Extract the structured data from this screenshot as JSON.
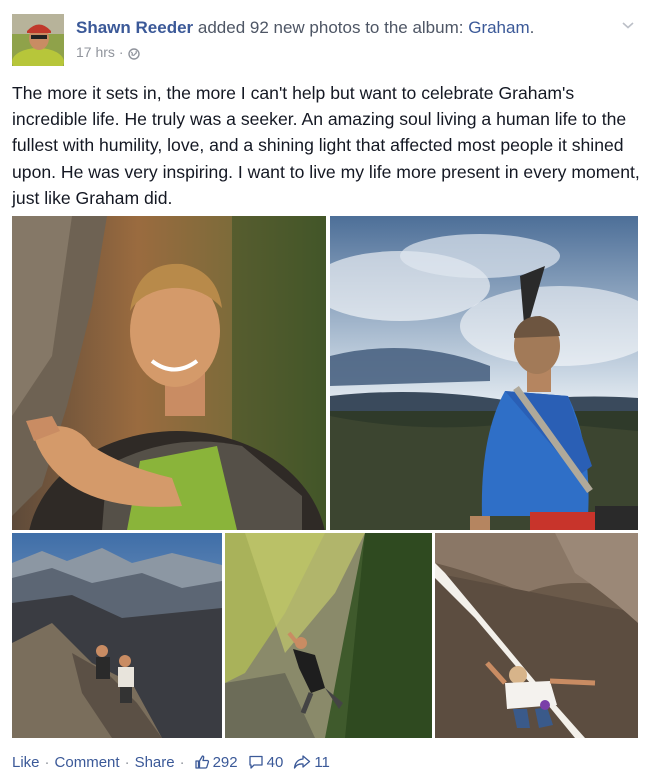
{
  "post": {
    "author": "Shawn Reeder",
    "action_text": "added 92 new photos to the album:",
    "album_name": "Graham",
    "album_suffix": ".",
    "time": "17 hrs",
    "time_separator": "·",
    "privacy_icon": "globe-icon",
    "menu_icon": "chevron-down-icon",
    "message": "The more it sets in, the more I can't help but want to celebrate Graham's incredible life. He truly was a seeker. An amazing soul living a human life to the fullest with humility, love, and a shining light that affected most people it shined upon. He was very inspiring. I want to live my life more present in every moment, just like Graham did."
  },
  "photos": [
    {
      "subject": "portrait-smiling-climber"
    },
    {
      "subject": "climber-on-summit-blue-shirt"
    },
    {
      "subject": "climbers-on-ridge"
    },
    {
      "subject": "climber-on-mossy-wall"
    },
    {
      "subject": "climber-in-roof-crack"
    }
  ],
  "actions": {
    "like": "Like",
    "comment": "Comment",
    "share": "Share",
    "separator": "·",
    "likes_count": "292",
    "comments_count": "40",
    "shares_count": "11",
    "like_icon": "thumbs-up-icon",
    "comment_icon": "comment-icon",
    "share_icon": "share-arrow-icon"
  },
  "colors": {
    "link": "#3b5998",
    "meta": "#90949c",
    "text": "#141823"
  }
}
